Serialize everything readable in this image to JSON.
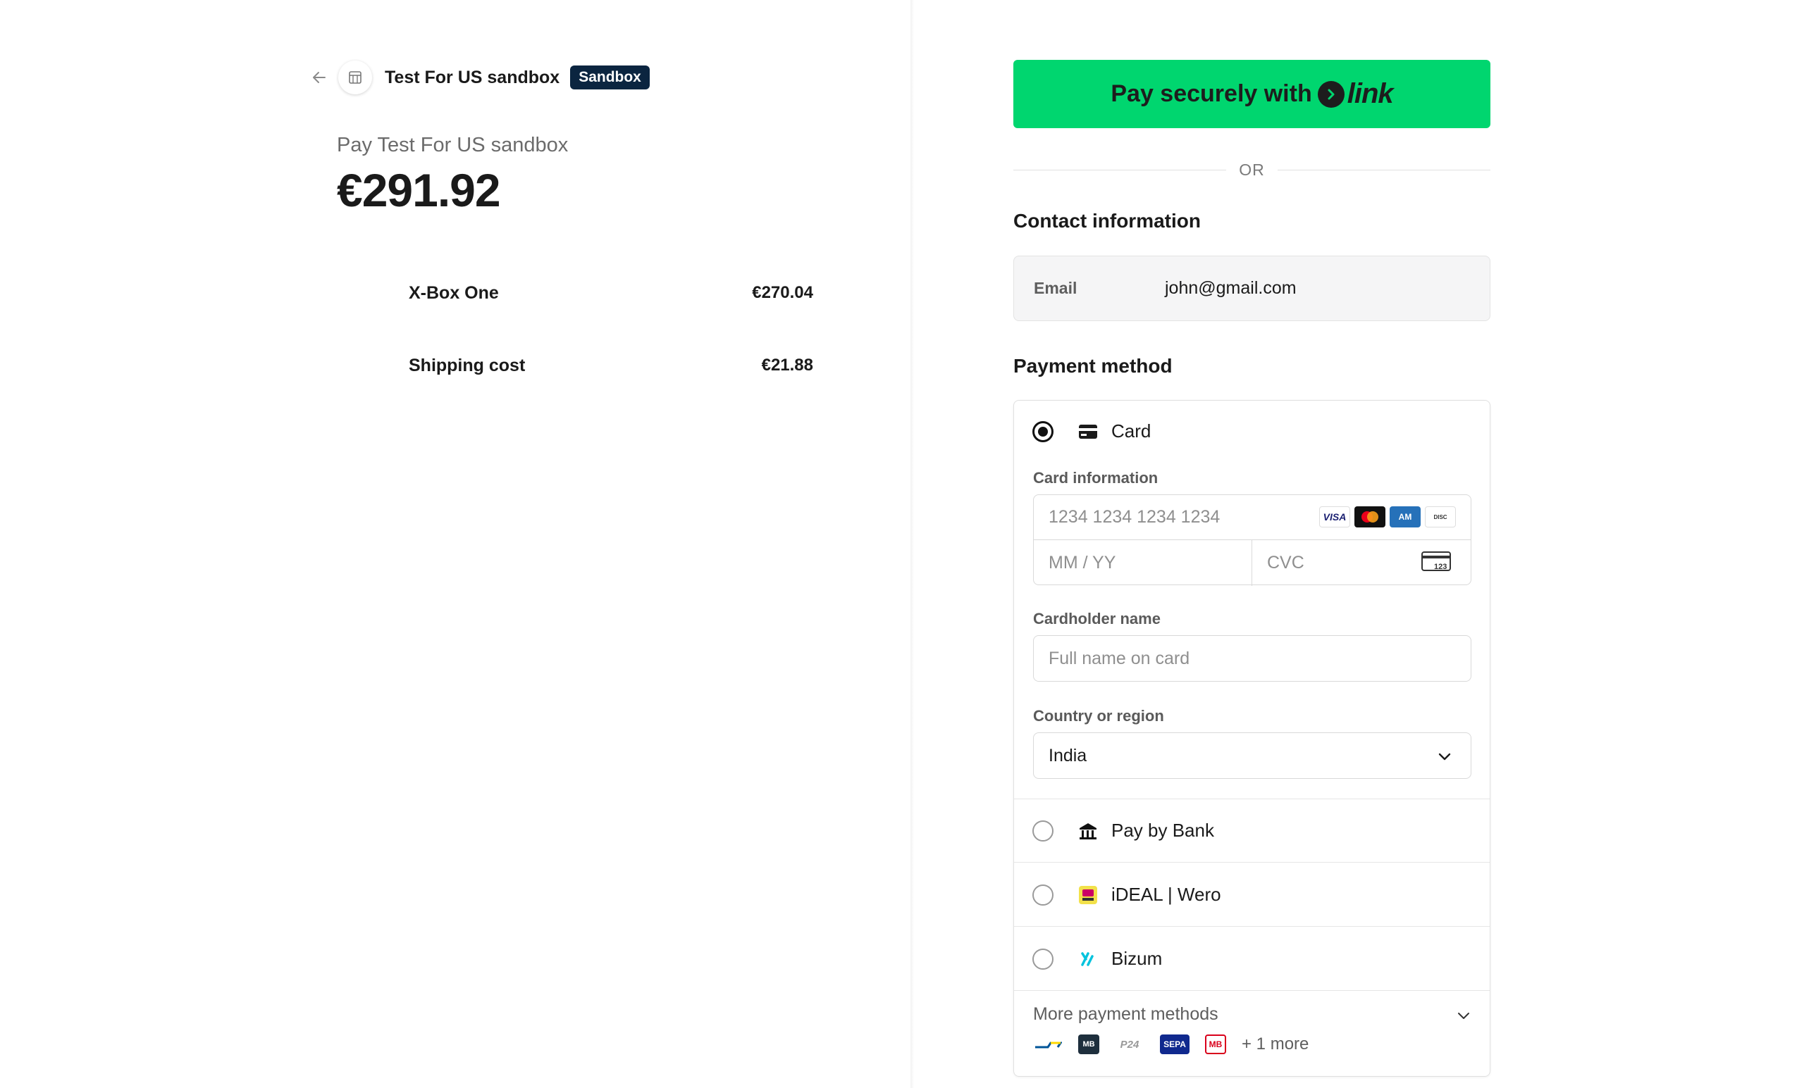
{
  "summary": {
    "merchant_name": "Test For US sandbox",
    "badge": "Sandbox",
    "pay_title": "Pay Test For US sandbox",
    "total": "€291.92",
    "line_items": [
      {
        "name": "X-Box One",
        "price": "€270.04"
      },
      {
        "name": "Shipping cost",
        "price": "€21.88"
      }
    ]
  },
  "checkout": {
    "link_button": {
      "prefix": "Pay securely with",
      "brand": "link"
    },
    "divider_text": "OR",
    "contact": {
      "title": "Contact information",
      "email_label": "Email",
      "email_value": "john@gmail.com"
    },
    "payment": {
      "title": "Payment method",
      "card": {
        "label": "Card",
        "card_info_label": "Card information",
        "card_number_placeholder": "1234 1234 1234 1234",
        "expiry_placeholder": "MM / YY",
        "cvc_placeholder": "CVC",
        "brands": [
          "VISA",
          "Mastercard",
          "AMEX",
          "DISCOVER"
        ],
        "cardholder_label": "Cardholder name",
        "cardholder_placeholder": "Full name on card",
        "country_label": "Country or region",
        "country_value": "India"
      },
      "methods": [
        {
          "label": "Pay by Bank",
          "icon": "bank-icon"
        },
        {
          "label": "iDEAL | Wero",
          "icon": "ideal-wero-icon"
        },
        {
          "label": "Bizum",
          "icon": "bizum-icon"
        }
      ],
      "more": {
        "label": "More payment methods",
        "extra_count": "+ 1 more",
        "icons": [
          "bancontact-icon",
          "multibanco-icon",
          "p24-icon",
          "sepa-icon",
          "mb-way-icon"
        ]
      }
    }
  },
  "colors": {
    "link_green": "#00d66f",
    "badge_bg": "#0b2540"
  }
}
